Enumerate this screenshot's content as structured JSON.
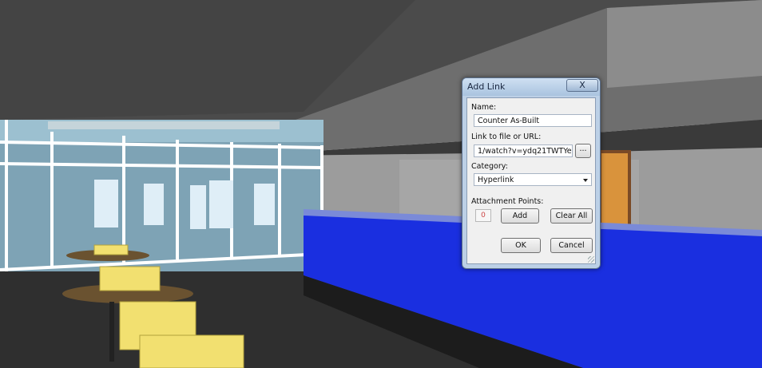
{
  "dialog": {
    "title": "Add Link",
    "close_glyph": "X",
    "name_label": "Name:",
    "name_value": "Counter As-Built",
    "url_label": "Link to file or URL:",
    "url_value": "1/watch?v=ydq21TWTYes",
    "browse_label": "...",
    "category_label": "Category:",
    "category_value": "Hyperlink",
    "attachment_label": "Attachment Points:",
    "attachment_count": "0",
    "add_label": "Add",
    "clear_all_label": "Clear All",
    "ok_label": "OK",
    "cancel_label": "Cancel"
  },
  "icons": {
    "close": "close-icon",
    "dropdown": "chevron-down-icon",
    "grip": "resize-grip-icon"
  },
  "colors": {
    "counter_blue": "#1a2fe0",
    "chair_yellow": "#f2e070",
    "ceiling": "#4a4a4a",
    "floor": "#2e2e2e",
    "glass": "#7fa2b4"
  }
}
